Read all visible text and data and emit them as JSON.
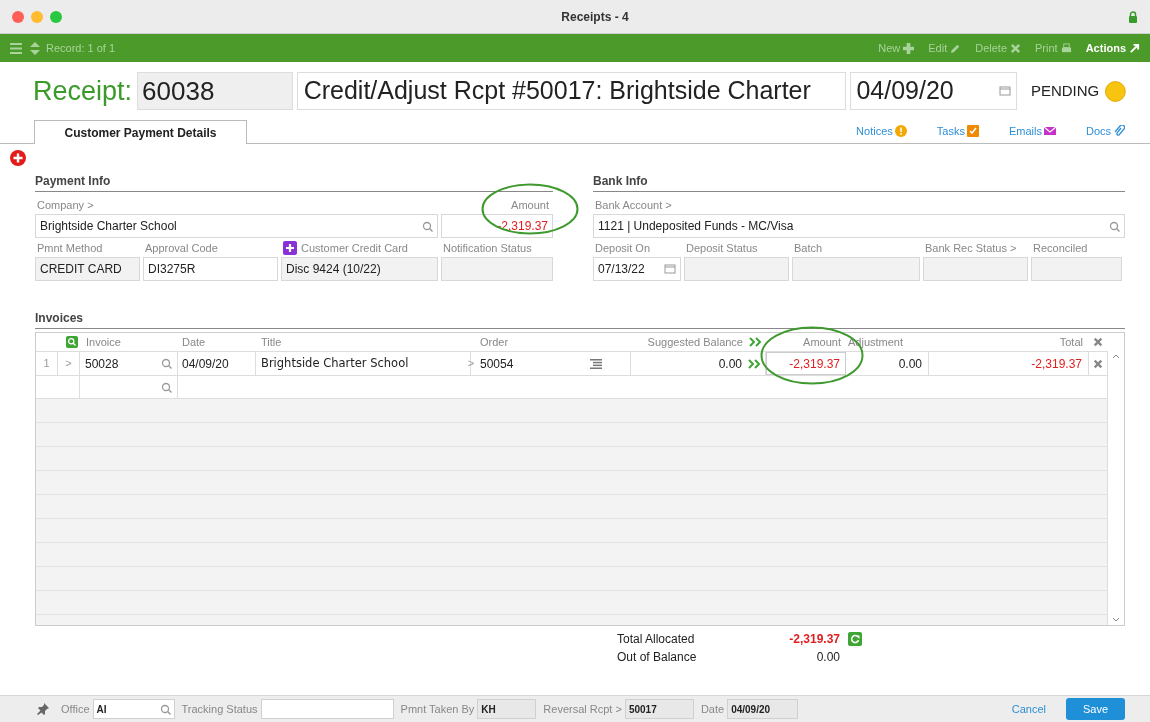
{
  "window": {
    "title": "Receipts - 4"
  },
  "toolbar": {
    "record": "Record: 1 of 1",
    "actions": [
      {
        "label": "New",
        "kind": "new",
        "enabled": false
      },
      {
        "label": "Edit",
        "kind": "edit",
        "enabled": false
      },
      {
        "label": "Delete",
        "kind": "delete",
        "enabled": false
      },
      {
        "label": "Print",
        "kind": "print",
        "enabled": false
      },
      {
        "label": "Actions",
        "kind": "actions",
        "enabled": true
      }
    ]
  },
  "header": {
    "label": "Receipt:",
    "number": "60038",
    "title": "Credit/Adjust Rcpt #50017: Brightside Charter",
    "date": "04/09/20",
    "status": "PENDING"
  },
  "tabs": [
    {
      "label": "Customer Payment Details",
      "selected": true
    }
  ],
  "links": [
    {
      "label": "Notices",
      "kind": "notices"
    },
    {
      "label": "Tasks",
      "kind": "tasks"
    },
    {
      "label": "Emails",
      "kind": "emails"
    },
    {
      "label": "Docs",
      "kind": "docs"
    }
  ],
  "payment_info": {
    "title": "Payment Info",
    "fields": [
      {
        "label": "Company >",
        "value": "Brightside Charter School",
        "kind": "search",
        "readonly": false
      },
      {
        "label": "Amount",
        "value": "-2,319.37",
        "kind": "amount",
        "readonly": false,
        "negative": true,
        "circled": true
      },
      {
        "label": "Pmnt Method",
        "value": "CREDIT CARD",
        "kind": "text",
        "readonly": true
      },
      {
        "label": "Approval Code",
        "value": "DI3275R",
        "kind": "text",
        "readonly": false
      },
      {
        "label": "Customer Credit Card",
        "value": "Disc 9424 (10/22)",
        "kind": "card",
        "readonly": true
      },
      {
        "label": "Notification Status",
        "kind": "text",
        "readonly": true
      }
    ]
  },
  "bank_info": {
    "title": "Bank Info",
    "fields": [
      {
        "label": "Bank Account >",
        "value": "1121 | Undeposited Funds - MC/Visa",
        "kind": "search",
        "readonly": false
      },
      {
        "label": "Deposit On",
        "value": "07/13/22",
        "kind": "date",
        "readonly": false
      },
      {
        "label": "Deposit Status",
        "kind": "text",
        "readonly": true
      },
      {
        "label": "Batch",
        "kind": "text",
        "readonly": true
      },
      {
        "label": "Bank Rec Status >",
        "kind": "text",
        "readonly": true
      },
      {
        "label": "Reconciled",
        "kind": "text",
        "readonly": true
      }
    ]
  },
  "invoices": {
    "title": "Invoices",
    "columns": [
      "Invoice",
      "Date",
      "Title",
      "Order",
      "Suggested Balance",
      "Amount",
      "Adjustment",
      "Total"
    ],
    "amount_circled": true,
    "rows": [
      {
        "num": "1",
        "expander": ">",
        "order_link": ">",
        "invoice": "50028",
        "date": "04/09/20",
        "title": "Brightside Charter School",
        "order": "50054",
        "suggested_balance": "0.00",
        "amount": "-2,319.37",
        "adjustment": "0.00",
        "total": "-2,319.37"
      }
    ]
  },
  "totals": [
    {
      "label": "Total Allocated",
      "value": "-2,319.37",
      "negative": true
    },
    {
      "label": "Out of Balance",
      "value": "0.00",
      "negative": false
    }
  ],
  "footer": {
    "fields": [
      {
        "label": "Office",
        "value": "AI",
        "kind": "search",
        "readonly": false
      },
      {
        "label": "Tracking Status",
        "kind": "text",
        "readonly": false
      },
      {
        "label": "Pmnt Taken By",
        "value": "KH",
        "kind": "text",
        "readonly": true
      },
      {
        "label": "Reversal Rcpt >",
        "value": "50017",
        "kind": "text",
        "readonly": true
      },
      {
        "label": "Date",
        "value": "04/09/20",
        "kind": "text",
        "readonly": true
      }
    ],
    "buttons": [
      {
        "label": "Cancel",
        "kind": "link"
      },
      {
        "label": "Save",
        "kind": "primary"
      }
    ]
  }
}
